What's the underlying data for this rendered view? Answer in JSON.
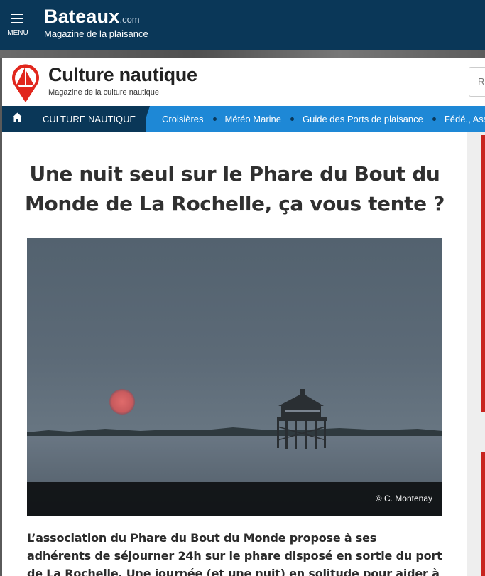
{
  "topbar": {
    "menu_label": "MENU",
    "brand_name": "Bateaux",
    "brand_tld": ".com",
    "brand_tagline": "Magazine de la plaisance"
  },
  "site": {
    "title": "Culture nautique",
    "subtitle": "Magazine de la culture nautique",
    "search_placeholder": "R"
  },
  "nav": {
    "home_icon": "home-icon",
    "current_section": "CULTURE NAUTIQUE",
    "links": [
      "Croisières",
      "Météo Marine",
      "Guide des Ports de plaisance",
      "Fédé., Ass"
    ]
  },
  "article": {
    "headline": "Une nuit seul sur le Phare du Bout du Monde de La Rochelle, ça vous tente ?",
    "photo_credit": "© C. Montenay",
    "lead": "L’association du Phare du Bout du Monde propose à ses adhérents de séjourner 24h sur le phare disposé en sortie du port de La Rochelle. Une journée (et une nuit) en solitude pour aider à créer. L’idée étant de"
  },
  "colors": {
    "topbar": "#0a3758",
    "nav": "#1e88d6",
    "logo_red": "#e1261c"
  }
}
